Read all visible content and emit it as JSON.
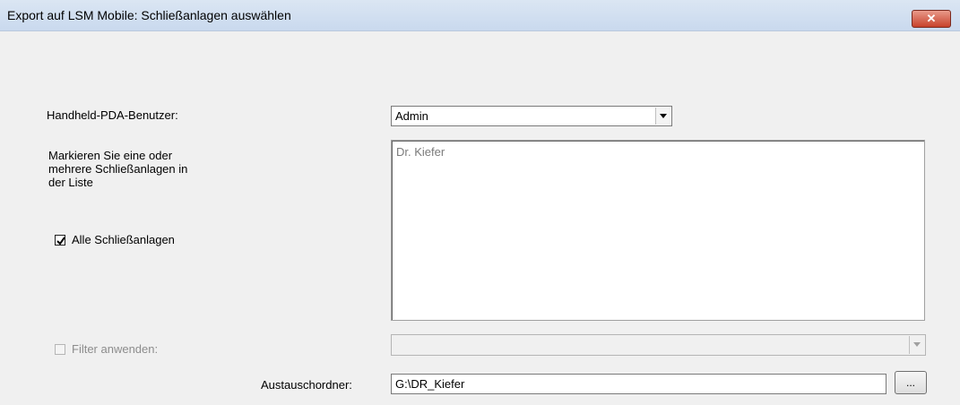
{
  "window": {
    "title": "Export auf LSM Mobile: Schließanlagen auswählen",
    "close_glyph": "✕"
  },
  "form": {
    "user_label": "Handheld-PDA-Benutzer:",
    "user_value": "Admin",
    "instruction": [
      "Markieren Sie eine oder",
      "mehrere Schließanlagen in",
      "der Liste"
    ],
    "all_checkbox_label": "Alle Schließanlagen",
    "all_checked": true,
    "list_items": [
      "Dr. Kiefer"
    ],
    "filter_label": "Filter anwenden:",
    "filter_checked": false,
    "filter_value": "",
    "folder_label": "Austauschordner:",
    "folder_value": "G:\\DR_Kiefer",
    "browse_label": "..."
  }
}
